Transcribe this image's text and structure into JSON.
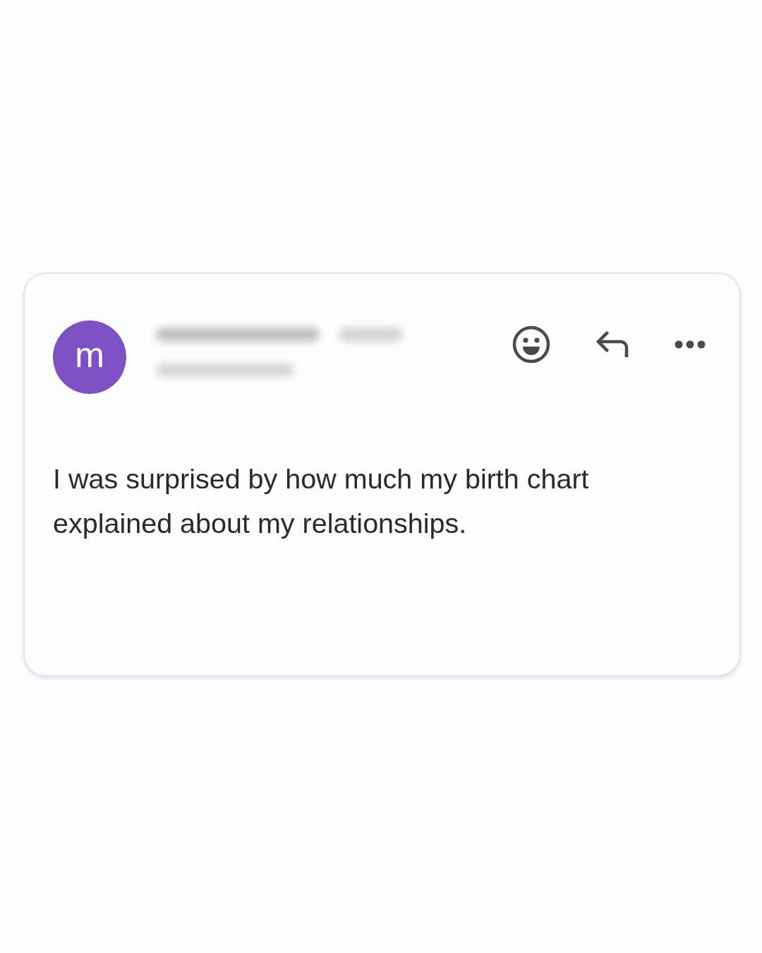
{
  "message": {
    "avatar_letter": "m",
    "body": "I was surprised by how much my birth chart explained about my relationships."
  }
}
